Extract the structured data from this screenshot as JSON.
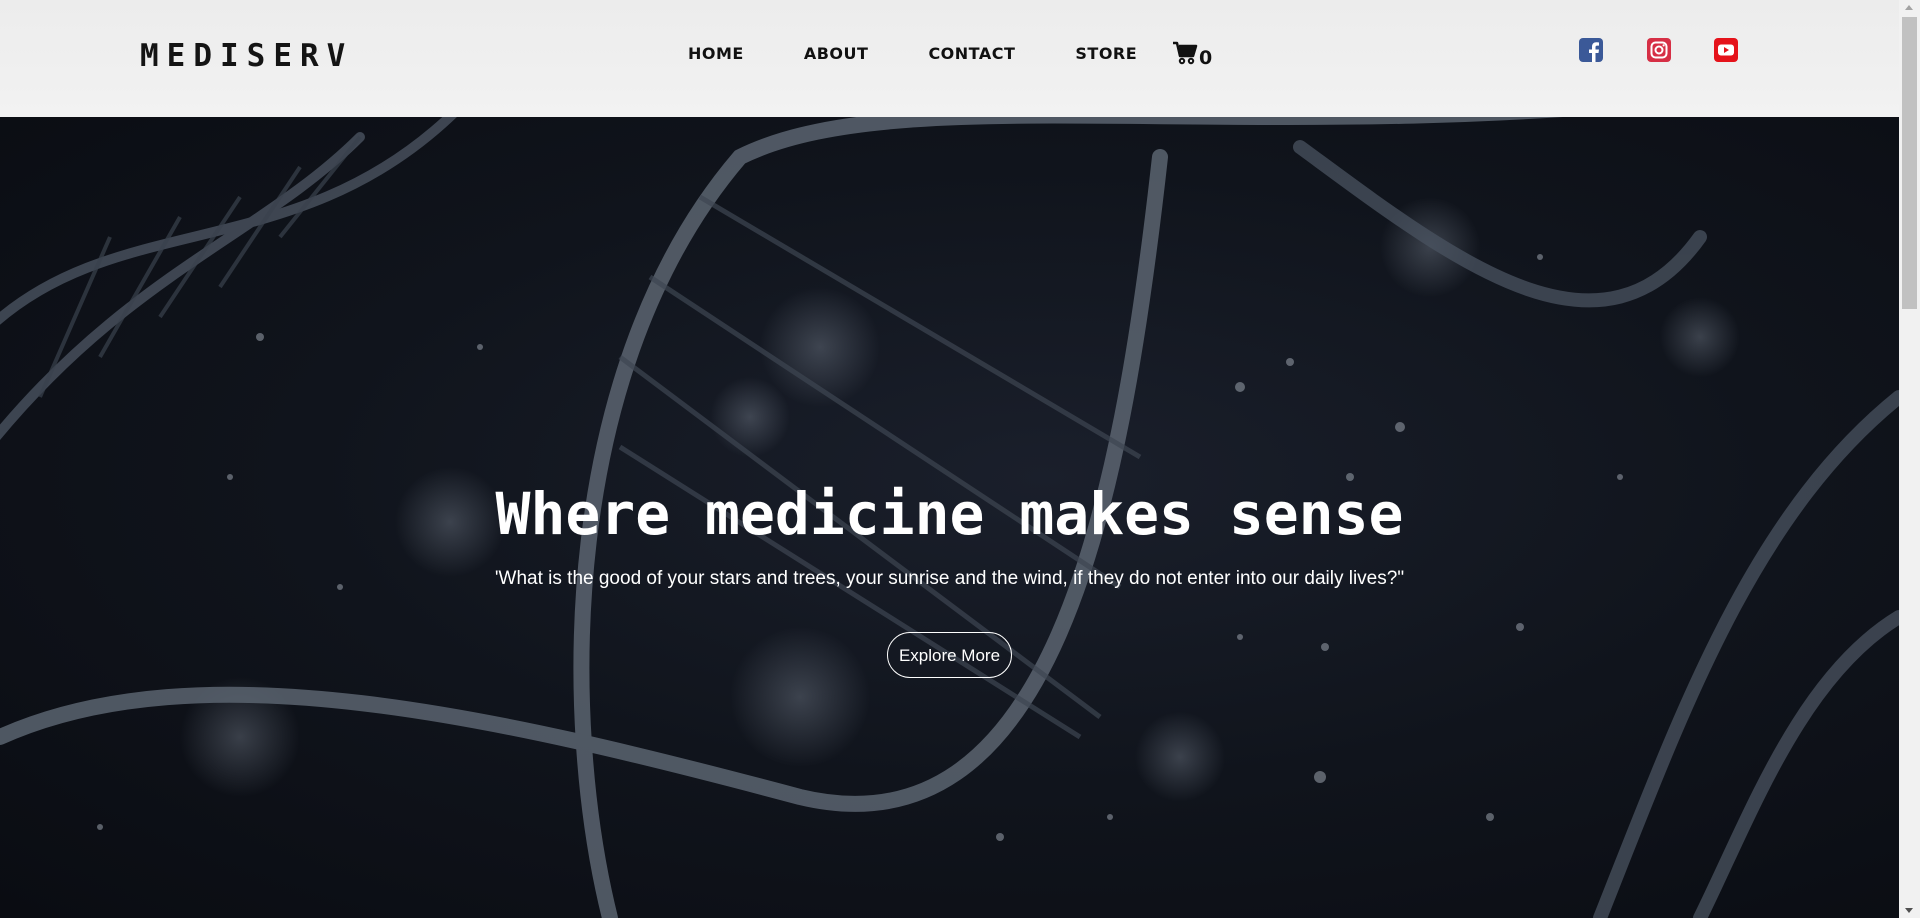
{
  "brand": {
    "logo_text": "MEDISERV"
  },
  "nav": {
    "items": [
      {
        "label": "HOME"
      },
      {
        "label": "ABOUT"
      },
      {
        "label": "CONTACT"
      },
      {
        "label": "STORE"
      }
    ],
    "cart_count": "0",
    "cart_icon": "shopping-cart-icon"
  },
  "social": {
    "items": [
      {
        "icon": "facebook-icon",
        "color": "#3b5998"
      },
      {
        "icon": "instagram-icon",
        "color": "#d62f45"
      },
      {
        "icon": "youtube-icon",
        "color": "#e5131b"
      }
    ]
  },
  "hero": {
    "title": "Where medicine makes sense",
    "quote": "'What is the good of your stars and trees, your sunrise and the wind, if they do not enter into our daily lives?\"",
    "button_label": "Explore More"
  },
  "colors": {
    "header_bg": "#efefef",
    "hero_bg": "#10141c",
    "text_light": "#ffffff"
  }
}
